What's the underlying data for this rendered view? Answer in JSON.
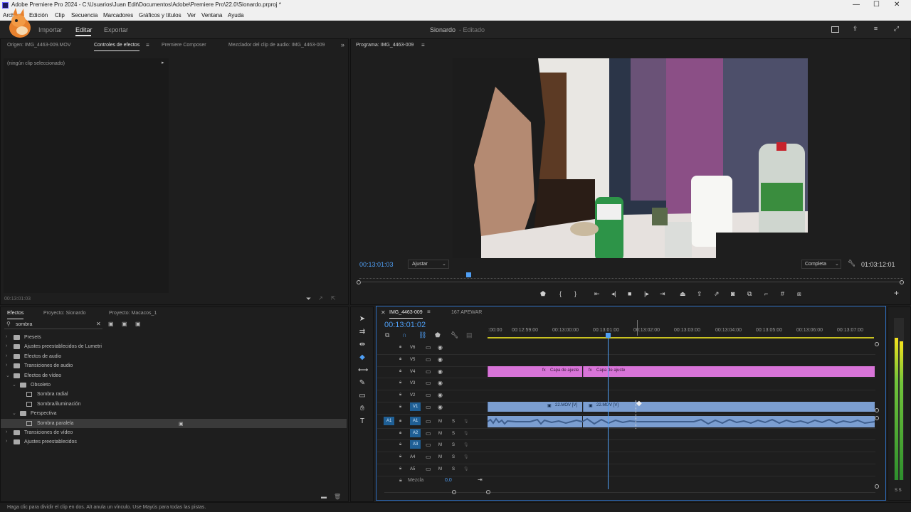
{
  "window": {
    "title": "Adobe Premiere Pro 2024 - C:\\Usuarios\\Juan Edit\\Documentos\\Adobe\\Premiere Pro\\22.0\\Sionardo.prproj *",
    "minimize": "—",
    "maximize": "☐",
    "close": "✕"
  },
  "menu": [
    "Archivo",
    "Edición",
    "Clip",
    "Secuencia",
    "Marcadores",
    "Gráficos y títulos",
    "Ver",
    "Ventana",
    "Ayuda"
  ],
  "workspace": {
    "nav": [
      "Importar",
      "Editar",
      "Exportar"
    ],
    "active": "Editar",
    "project_name": "Sionardo",
    "project_status": "- Editado"
  },
  "source_panel": {
    "tabs": [
      "Origen: IMG_4463-009.MOV",
      "Controles de efectos",
      "Premiere Composer",
      "Mezclador del clip de audio: IMG_4463-009"
    ],
    "active_tab": "Controles de efectos",
    "no_clip": "(ningún clip seleccionado)",
    "timecode": "00:13:01:03"
  },
  "program_panel": {
    "tab": "Programa: IMG_4463-009",
    "timecode": "00:13:01:03",
    "fit": "Ajustar",
    "quality": "Completa",
    "duration": "01:03:12:01"
  },
  "effects_panel": {
    "tabs": [
      "Efectos",
      "Proyecto: Sionardo",
      "Proyecto: Macacos_1"
    ],
    "active_tab": "Efectos",
    "search_value": "sombra",
    "tree": [
      {
        "label": "Presets",
        "level": 0,
        "type": "folder",
        "open": false
      },
      {
        "label": "Ajustes preestablecidos de Lumetri",
        "level": 0,
        "type": "folder",
        "open": false
      },
      {
        "label": "Efectos de audio",
        "level": 0,
        "type": "folder",
        "open": false
      },
      {
        "label": "Transiciones de audio",
        "level": 0,
        "type": "folder",
        "open": false
      },
      {
        "label": "Efectos de vídeo",
        "level": 0,
        "type": "folder",
        "open": true
      },
      {
        "label": "Obsoleto",
        "level": 1,
        "type": "folder",
        "open": true
      },
      {
        "label": "Sombra radial",
        "level": 2,
        "type": "effect"
      },
      {
        "label": "Sombra/iluminación",
        "level": 2,
        "type": "effect"
      },
      {
        "label": "Perspectiva",
        "level": 1,
        "type": "folder",
        "open": true
      },
      {
        "label": "Sombra paralela",
        "level": 2,
        "type": "effect",
        "selected": true
      },
      {
        "label": "Transiciones de vídeo",
        "level": 0,
        "type": "folder",
        "open": false
      },
      {
        "label": "Ajustes preestablecidos",
        "level": 0,
        "type": "folder",
        "open": false
      }
    ]
  },
  "timeline": {
    "tabs": [
      "IMG_4463-009",
      "167 APEWAR"
    ],
    "active_tab": "IMG_4463-009",
    "timecode": "00:13:01:02",
    "ruler": [
      ":00:00",
      "00:12:59:00",
      "00:13:00:00",
      "00:13:01:00",
      "00:13:02:00",
      "00:13:03:00",
      "00:13:04:00",
      "00:13:05:00",
      "00:13:06:00",
      "00:13:07:00"
    ],
    "video_tracks": [
      "V6",
      "V5",
      "V4",
      "V3",
      "V2",
      "V1"
    ],
    "audio_tracks": [
      "A1",
      "A2",
      "A3",
      "A4",
      "A5"
    ],
    "source_patch": "A1",
    "mix_label": "Mezcla",
    "mix_value": "0,0",
    "clips": {
      "adjustment_1": "Capa de ajuste",
      "adjustment_2": "Capa de ajuste",
      "video_1": "22.MOV [V]",
      "video_2": "22.MOV [V]"
    },
    "audio_buttons": {
      "mute": "M",
      "solo": "S"
    }
  },
  "meter": {
    "labels": "S S"
  },
  "status_bar": "Haga clic para dividir el clip en dos. Alt anula un vínculo. Use Mayús para todas las pistas.",
  "colors": {
    "accent": "#4f9ff5",
    "adjustment_clip": "#d874d8",
    "video_clip": "#7b9ed1",
    "audio_clip": "#7b9ed1"
  }
}
